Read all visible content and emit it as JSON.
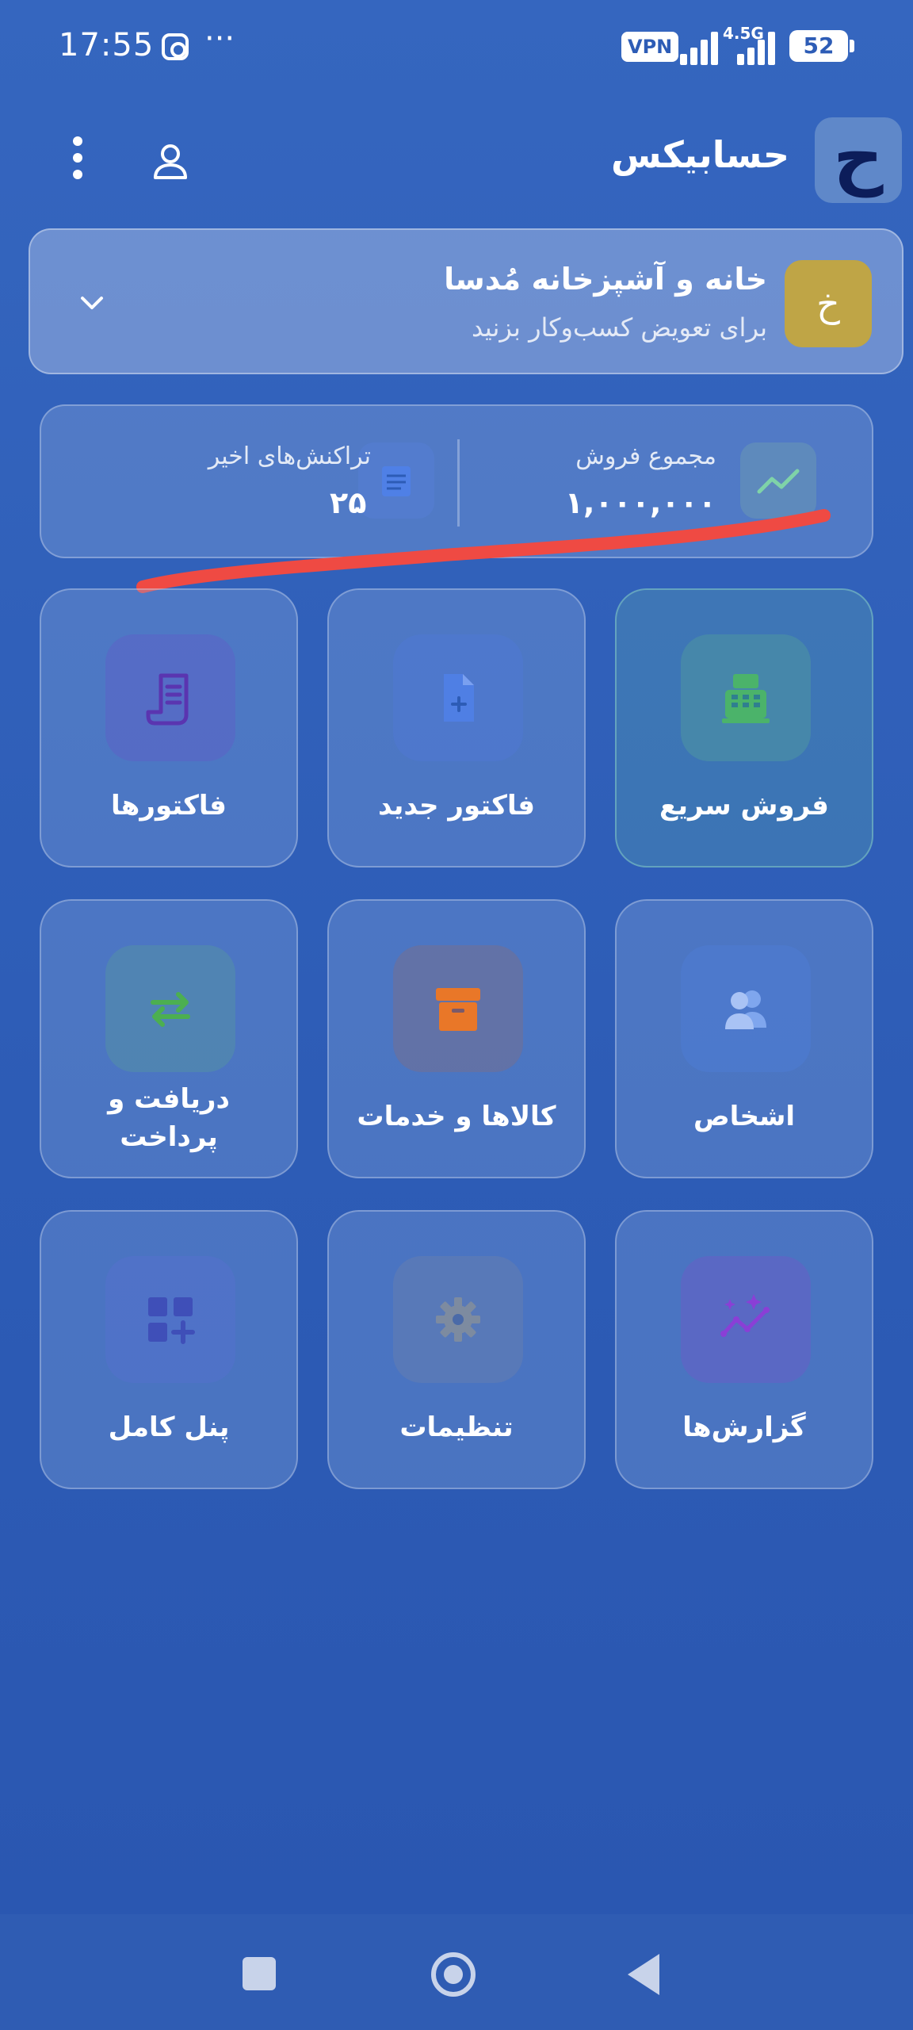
{
  "status_bar": {
    "time": "17:55",
    "dots": "···",
    "vpn": "VPN",
    "network": "4.5G",
    "battery": "52"
  },
  "header": {
    "logo_glyph": "ح",
    "title": "حسابیکس"
  },
  "business": {
    "avatar_letter": "خ",
    "name": "خانه و آشپزخانه مُدسا",
    "hint": "برای تعویض کسب‌وکار بزنید"
  },
  "stats": {
    "sales_label": "مجموع فروش",
    "sales_value": "۱,۰۰۰,۰۰۰",
    "transactions_label": "تراکنش‌های اخیر",
    "transactions_value": "۲۵"
  },
  "tiles": [
    {
      "label": "فروش سریع",
      "icon": "cash-register-icon"
    },
    {
      "label": "فاکتور جدید",
      "icon": "new-invoice-icon"
    },
    {
      "label": "فاکتورها",
      "icon": "receipt-icon"
    },
    {
      "label": "اشخاص",
      "icon": "people-icon"
    },
    {
      "label": "کالاها و خدمات",
      "icon": "archive-box-icon"
    },
    {
      "label": "دریافت و پرداخت",
      "icon": "transfer-arrows-icon"
    },
    {
      "label": "گزارش‌ها",
      "icon": "analytics-icon"
    },
    {
      "label": "تنظیمات",
      "icon": "gear-icon"
    },
    {
      "label": "پنل کامل",
      "icon": "grid-add-icon"
    }
  ],
  "colors": {
    "background": "#2d5cb6",
    "business_avatar": "#bfa546",
    "annotation": "#ef4a43",
    "cash_register": "#4bb36a",
    "receipt": "#5a35b0",
    "archive": "#e97728",
    "transfer": "#4caf50",
    "analytics": "#8a3fd6"
  }
}
